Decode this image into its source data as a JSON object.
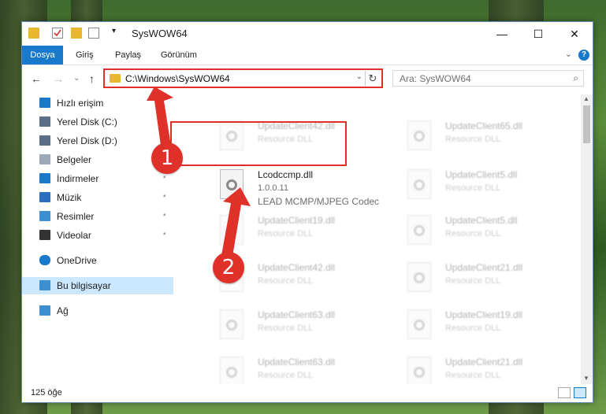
{
  "window": {
    "title": "SysWOW64",
    "minimize": "—",
    "maximize": "☐",
    "close": "✕"
  },
  "ribbon": {
    "tabs": [
      "Dosya",
      "Giriş",
      "Paylaş",
      "Görünüm"
    ],
    "help": "?",
    "collapse": "⌄"
  },
  "nav": {
    "back": "←",
    "forward": "→",
    "recent": "⌄",
    "up": "↑",
    "address": "C:\\Windows\\SysWOW64",
    "refresh": "↻",
    "search_placeholder": "Ara: SysWOW64",
    "search_icon": "⌕"
  },
  "sidebar": {
    "items": [
      {
        "label": "Hızlı erişim",
        "icon": "star-icon",
        "pinned": false
      },
      {
        "label": "Yerel Disk (C:)",
        "icon": "drive-icon",
        "pinned": true
      },
      {
        "label": "Yerel Disk (D:)",
        "icon": "drive-icon",
        "pinned": true
      },
      {
        "label": "Belgeler",
        "icon": "documents-icon",
        "pinned": true
      },
      {
        "label": "İndirmeler",
        "icon": "download-icon",
        "pinned": true
      },
      {
        "label": "Müzik",
        "icon": "music-icon",
        "pinned": true
      },
      {
        "label": "Resimler",
        "icon": "pictures-icon",
        "pinned": true
      },
      {
        "label": "Videolar",
        "icon": "videos-icon",
        "pinned": true
      },
      {
        "label": "OneDrive",
        "icon": "cloud-icon",
        "pinned": false
      },
      {
        "label": "Bu bilgisayar",
        "icon": "computer-icon",
        "pinned": false,
        "selected": true
      },
      {
        "label": "Ağ",
        "icon": "network-icon",
        "pinned": false
      }
    ],
    "pin_glyph": "📌"
  },
  "files": {
    "featured": {
      "name": "Lcodccmp.dll",
      "version": "1.0.0.11",
      "description": "LEAD MCMP/MJPEG Codec"
    },
    "left_column": [
      {
        "name": "UpdateClient42.dll",
        "type": "Resource DLL"
      },
      {
        "name": "UpdateClient19.dll",
        "type": "Resource DLL"
      },
      {
        "name": "UpdateClient42.dll",
        "type": "Resource DLL"
      },
      {
        "name": "UpdateClient63.dll",
        "type": "Resource DLL"
      },
      {
        "name": "UpdateClient63.dll",
        "type": "Resource DLL"
      }
    ],
    "right_column": [
      {
        "name": "UpdateClient65.dll",
        "type": "Resource DLL"
      },
      {
        "name": "UpdateClient5.dll",
        "type": "Resource DLL"
      },
      {
        "name": "UpdateClient5.dll",
        "type": "Resource DLL"
      },
      {
        "name": "UpdateClient21.dll",
        "type": "Resource DLL"
      },
      {
        "name": "UpdateClient19.dll",
        "type": "Resource DLL"
      },
      {
        "name": "UpdateClient21.dll",
        "type": "Resource DLL"
      }
    ]
  },
  "status": {
    "item_count": "125 öğe"
  },
  "callouts": {
    "one": "1",
    "two": "2"
  },
  "colors": {
    "accent": "#1979ca",
    "highlight": "#e0302a",
    "selection": "#cce8ff"
  }
}
